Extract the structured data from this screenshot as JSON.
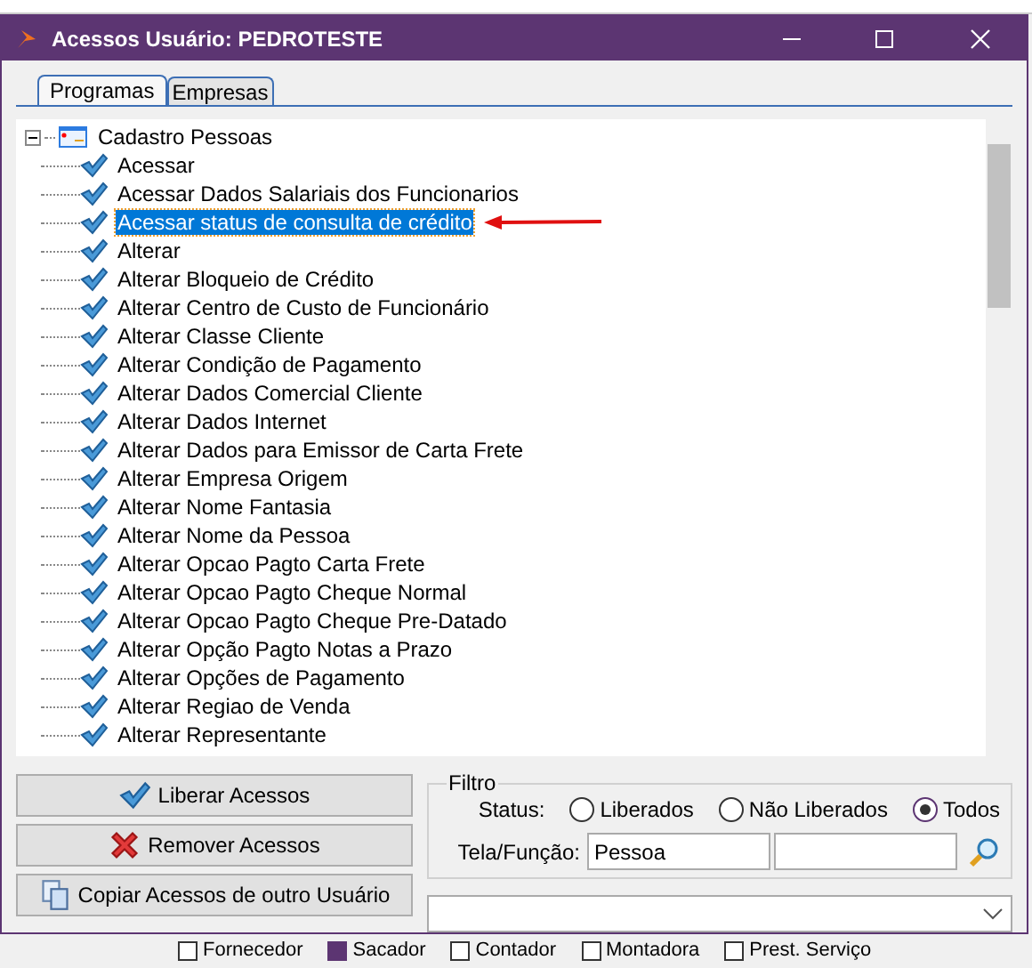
{
  "window": {
    "title": "Acessos Usuário: PEDROTESTE"
  },
  "tabs": [
    {
      "label": "Programas",
      "selected": true
    },
    {
      "label": "Empresas",
      "selected": false
    }
  ],
  "tree": {
    "label": "Cadastro Pessoas",
    "expanded": true,
    "children": [
      {
        "label": "Acessar",
        "checked": true,
        "selected": false
      },
      {
        "label": "Acessar Dados Salariais dos Funcionarios",
        "checked": true,
        "selected": false
      },
      {
        "label": "Acessar status de consulta de crédito",
        "checked": true,
        "selected": true
      },
      {
        "label": "Alterar",
        "checked": true,
        "selected": false
      },
      {
        "label": "Alterar Bloqueio de Crédito",
        "checked": true,
        "selected": false
      },
      {
        "label": "Alterar Centro de Custo de Funcionário",
        "checked": true,
        "selected": false
      },
      {
        "label": "Alterar Classe Cliente",
        "checked": true,
        "selected": false
      },
      {
        "label": "Alterar Condição de Pagamento",
        "checked": true,
        "selected": false
      },
      {
        "label": "Alterar Dados Comercial Cliente",
        "checked": true,
        "selected": false
      },
      {
        "label": "Alterar Dados Internet",
        "checked": true,
        "selected": false
      },
      {
        "label": "Alterar Dados para Emissor de Carta Frete",
        "checked": true,
        "selected": false
      },
      {
        "label": "Alterar Empresa Origem",
        "checked": true,
        "selected": false
      },
      {
        "label": "Alterar Nome Fantasia",
        "checked": true,
        "selected": false
      },
      {
        "label": "Alterar Nome da Pessoa",
        "checked": true,
        "selected": false
      },
      {
        "label": "Alterar Opcao Pagto Carta Frete",
        "checked": true,
        "selected": false
      },
      {
        "label": "Alterar Opcao Pagto Cheque Normal",
        "checked": true,
        "selected": false
      },
      {
        "label": "Alterar Opcao Pagto Cheque Pre-Datado",
        "checked": true,
        "selected": false
      },
      {
        "label": "Alterar Opção Pagto Notas a Prazo",
        "checked": true,
        "selected": false
      },
      {
        "label": "Alterar Opções de Pagamento",
        "checked": true,
        "selected": false
      },
      {
        "label": "Alterar Regiao de Venda",
        "checked": true,
        "selected": false
      },
      {
        "label": "Alterar Representante",
        "checked": true,
        "selected": false
      }
    ]
  },
  "buttons": [
    {
      "label": "Liberar Acessos",
      "kind": "check"
    },
    {
      "label": "Remover Acessos",
      "kind": "remove"
    },
    {
      "label": "Copiar Acessos de outro Usuário",
      "kind": "copy"
    }
  ],
  "filter": {
    "title": "Filtro",
    "status_label": "Status:",
    "options": [
      {
        "label": "Liberados",
        "selected": false
      },
      {
        "label": "Não Liberados",
        "selected": false
      },
      {
        "label": "Todos",
        "selected": true
      }
    ],
    "screen_label": "Tela/Função:",
    "screen_value": "Pessoa"
  },
  "background_window": {
    "checkboxes": [
      {
        "label": "Fornecedor",
        "checked": false
      },
      {
        "label": "Sacador",
        "checked": true
      },
      {
        "label": "Contador",
        "checked": false
      },
      {
        "label": "Montadora",
        "checked": false
      },
      {
        "label": "Prest. Serviço",
        "checked": false
      }
    ]
  }
}
